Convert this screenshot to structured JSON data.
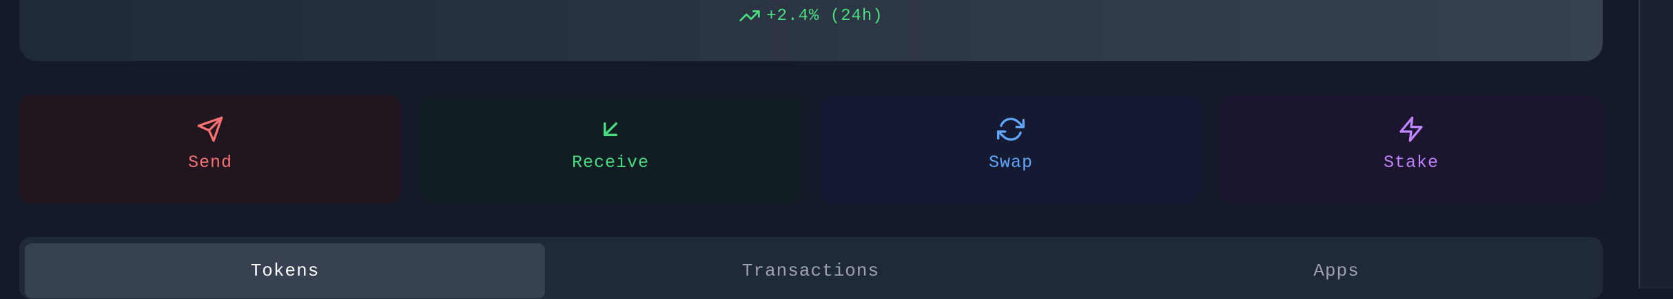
{
  "balance": {
    "change_text": "+2.4% (24h)",
    "change_icon": "trending-up-icon",
    "change_color": "#4ade80"
  },
  "actions": [
    {
      "label": "Send",
      "icon": "send-icon",
      "color": "#f87171"
    },
    {
      "label": "Receive",
      "icon": "arrow-down-left-icon",
      "color": "#4ade80"
    },
    {
      "label": "Swap",
      "icon": "refresh-icon",
      "color": "#60a5fa"
    },
    {
      "label": "Stake",
      "icon": "zap-icon",
      "color": "#c084fc"
    }
  ],
  "tabs": [
    {
      "label": "Tokens",
      "active": true
    },
    {
      "label": "Transactions",
      "active": false
    },
    {
      "label": "Apps",
      "active": false
    }
  ]
}
